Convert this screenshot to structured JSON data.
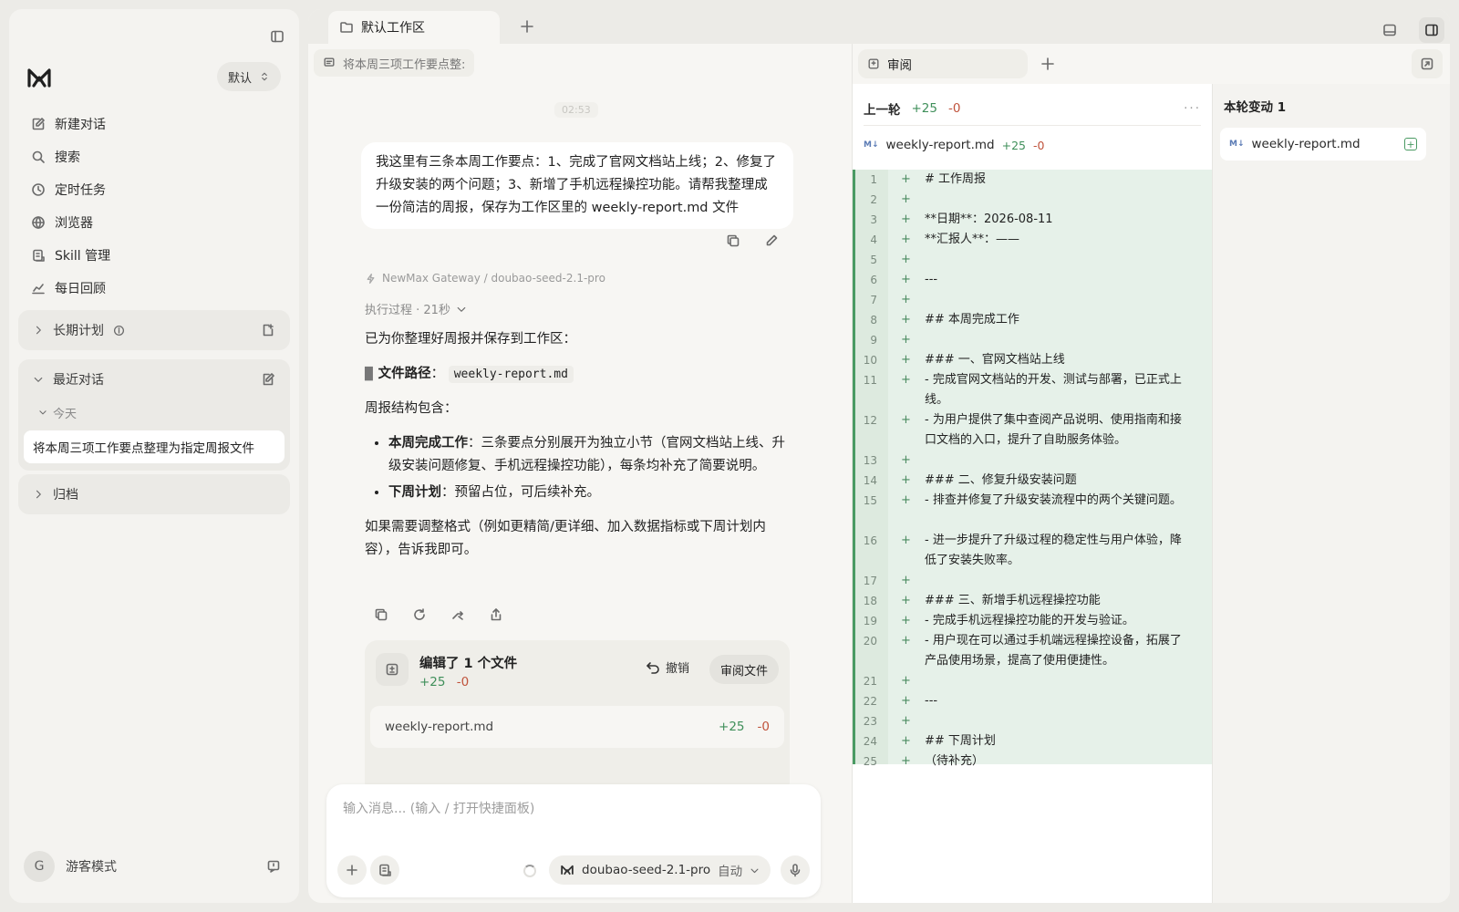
{
  "sidebar": {
    "workspace": "默认",
    "nav": [
      {
        "label": "新建对话",
        "icon": "edit-icon"
      },
      {
        "label": "搜索",
        "icon": "search-icon"
      },
      {
        "label": "定时任务",
        "icon": "clock-icon"
      },
      {
        "label": "浏览器",
        "icon": "globe-icon"
      },
      {
        "label": "Skill 管理",
        "icon": "skill-icon"
      },
      {
        "label": "每日回顾",
        "icon": "chart-icon"
      }
    ],
    "long_term": {
      "label": "长期计划"
    },
    "recent": {
      "label": "最近对话",
      "today_label": "今天",
      "items": [
        "将本周三项工作要点整理为指定周报文件"
      ]
    },
    "archive": {
      "label": "归档"
    },
    "guest": {
      "avatar": "G",
      "label": "游客模式"
    }
  },
  "tabs": {
    "workspace_tab": "默认工作区"
  },
  "chat": {
    "header_title": "将本周三项工作要点整:",
    "timestamp": "02:53",
    "user_message": "我这里有三条本周工作要点：1、完成了官网文档站上线；2、修复了升级安装的两个问题；3、新增了手机远程操控功能。请帮我整理成一份简洁的周报，保存为工作区里的 weekly-report.md 文件",
    "model_line": "NewMax Gateway / doubao-seed-2.1-pro",
    "exec_line": "执行过程 · 21秒",
    "answer": {
      "intro": "已为你整理好周报并保存到工作区：",
      "path_label": "文件路径",
      "path_value": "weekly-report.md",
      "structure_label": "周报结构包含：",
      "bullets": [
        {
          "bold": "本周完成工作",
          "text": "：三条要点分别展开为独立小节（官网文档站上线、升级安装问题修复、手机远程操控功能），每条均补充了简要说明。"
        },
        {
          "bold": "下周计划",
          "text": "：预留占位，可后续补充。"
        }
      ],
      "outro": "如果需要调整格式（例如更精简/更详细、加入数据指标或下周计划内容），告诉我即可。"
    },
    "edit_card": {
      "title": "编辑了 1 个文件",
      "plus": "+25",
      "minus": "-0",
      "undo": "撤销",
      "review": "审阅文件",
      "file": "weekly-report.md",
      "file_plus": "+25",
      "file_minus": "-0"
    },
    "composer": {
      "placeholder": "输入消息... (输入 / 打开快捷面板)",
      "model": "doubao-seed-2.1-pro",
      "mode": "自动"
    }
  },
  "review": {
    "tab": "审阅",
    "round_label": "上一轮",
    "plus": "+25",
    "minus": "-0",
    "file": "weekly-report.md",
    "file_plus": "+25",
    "file_minus": "-0",
    "md_badge": "M↓",
    "lines": [
      {
        "n": "1",
        "t": "# 工作周报"
      },
      {
        "n": "2",
        "t": ""
      },
      {
        "n": "3",
        "t": "**日期**：2026-08-11"
      },
      {
        "n": "4",
        "t": "**汇报人**：——"
      },
      {
        "n": "5",
        "t": ""
      },
      {
        "n": "6",
        "t": "---"
      },
      {
        "n": "7",
        "t": ""
      },
      {
        "n": "8",
        "t": "## 本周完成工作"
      },
      {
        "n": "9",
        "t": ""
      },
      {
        "n": "10",
        "t": "### 一、官网文档站上线"
      },
      {
        "n": "11",
        "t": "- 完成官网文档站的开发、测试与部署，已正式上线。"
      },
      {
        "n": "12",
        "t": "- 为用户提供了集中查阅产品说明、使用指南和接口文档的入口，提升了自助服务体验。"
      },
      {
        "n": "13",
        "t": ""
      },
      {
        "n": "14",
        "t": "### 二、修复升级安装问题"
      },
      {
        "n": "15",
        "t": "- 排查并修复了升级安装流程中的两个关键问题。"
      },
      {
        "n": "16",
        "t": "- 进一步提升了升级过程的稳定性与用户体验，降低了安装失败率。"
      },
      {
        "n": "17",
        "t": ""
      },
      {
        "n": "18",
        "t": "### 三、新增手机远程操控功能"
      },
      {
        "n": "19",
        "t": "- 完成手机远程操控功能的开发与验证。"
      },
      {
        "n": "20",
        "t": "- 用户现在可以通过手机端远程操控设备，拓展了产品使用场景，提高了使用便捷性。"
      },
      {
        "n": "21",
        "t": ""
      },
      {
        "n": "22",
        "t": "---"
      },
      {
        "n": "23",
        "t": ""
      },
      {
        "n": "24",
        "t": "## 下周计划"
      },
      {
        "n": "25",
        "t": "（待补充）"
      }
    ]
  },
  "changes": {
    "title": "本轮变动 1",
    "file": "weekly-report.md"
  },
  "colors": {
    "plus": "#3f8f5a",
    "minus": "#c0533c",
    "diff_bg": "#e6f1e9",
    "diff_bar": "#4a9a63"
  }
}
